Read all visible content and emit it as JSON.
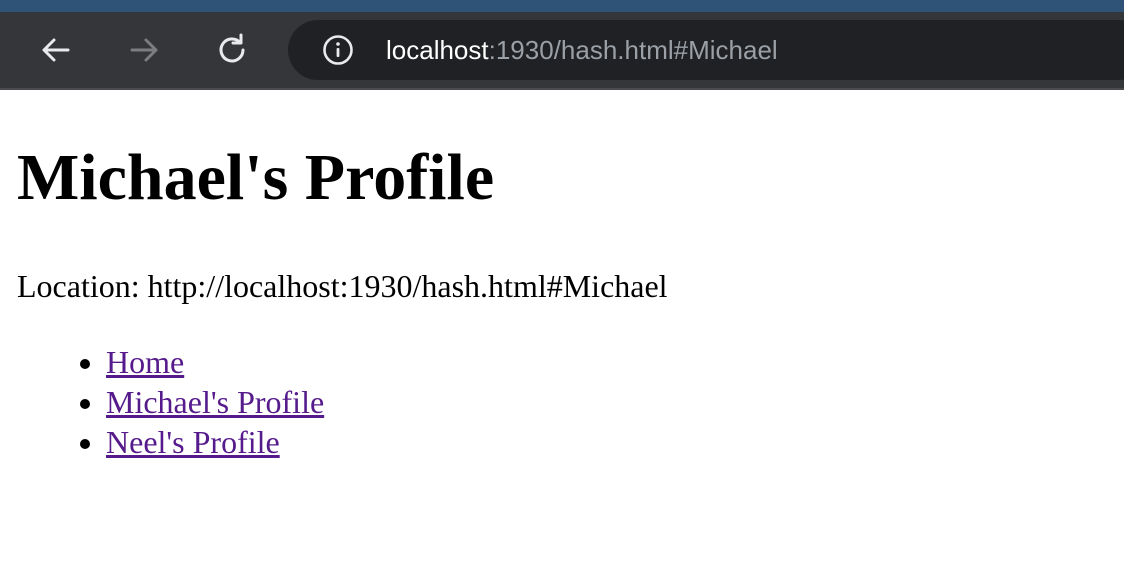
{
  "browser": {
    "url_host": "localhost",
    "url_rest": ":1930/hash.html#Michael",
    "colors": {
      "toolbar": "#35363a",
      "omnibox": "#202124",
      "top_strip": "#2f5277",
      "url_host": "#ffffff",
      "url_rest": "#9aa0a6"
    },
    "icons": {
      "back": "arrow-left-icon",
      "forward": "arrow-right-icon",
      "reload": "reload-icon",
      "info": "info-icon"
    }
  },
  "page": {
    "title": "Michael's Profile",
    "location_label": "Location: ",
    "location_value": "http://localhost:1930/hash.html#Michael",
    "links": [
      {
        "label": "Home"
      },
      {
        "label": "Michael's Profile"
      },
      {
        "label": "Neel's Profile"
      }
    ],
    "colors": {
      "link_visited": "#551a8b",
      "text": "#000000"
    }
  }
}
